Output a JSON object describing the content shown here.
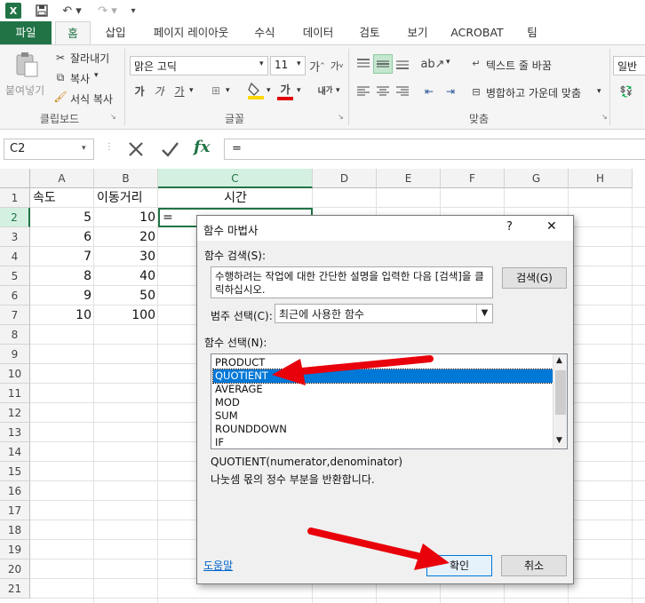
{
  "tabs": {
    "file": "파일",
    "home": "홈",
    "insert": "삽입",
    "page_layout": "페이지 레이아웃",
    "formulas": "수식",
    "data": "데이터",
    "review": "검토",
    "view": "보기",
    "acrobat": "ACROBAT",
    "team": "팀"
  },
  "ribbon": {
    "paste": "붙여넣기",
    "cut": "잘라내기",
    "copy": "복사",
    "format_painter": "서식 복사",
    "clipboard_group": "클립보드",
    "font_name": "맑은 고딕",
    "font_size": "11",
    "font_group": "글꼴",
    "wrap_text": "텍스트 줄 바꿈",
    "merge_center": "병합하고 가운데 맞춤",
    "alignment_group": "맞춤",
    "number_format": "일반"
  },
  "formula_bar": {
    "name_box": "C2",
    "fx": "fx",
    "content": "="
  },
  "sheet": {
    "columns": [
      "A",
      "B",
      "C",
      "D",
      "E",
      "F",
      "G",
      "H"
    ],
    "rows": [
      "1",
      "2",
      "3",
      "4",
      "5",
      "6",
      "7",
      "8",
      "9",
      "10",
      "11",
      "12",
      "13",
      "14",
      "15",
      "16",
      "17",
      "18",
      "19",
      "20",
      "21"
    ],
    "header_row": {
      "a": "속도",
      "b": "이동거리",
      "c": "시간"
    },
    "data": [
      {
        "a": "5",
        "b": "10",
        "c": "="
      },
      {
        "a": "6",
        "b": "20"
      },
      {
        "a": "7",
        "b": "30"
      },
      {
        "a": "8",
        "b": "40"
      },
      {
        "a": "9",
        "b": "50"
      },
      {
        "a": "10",
        "b": "100"
      }
    ]
  },
  "dialog": {
    "title": "함수 마법사",
    "help": "?",
    "close": "✕",
    "search_label": "함수 검색(S):",
    "search_text": "수행하려는 작업에 대한 간단한 설명을 입력한 다음 [검색]을 클릭하십시오.",
    "search_button": "검색(G)",
    "category_label": "범주 선택(C):",
    "category_value": "최근에 사용한 함수",
    "function_label": "함수 선택(N):",
    "functions": [
      "PRODUCT",
      "QUOTIENT",
      "AVERAGE",
      "MOD",
      "SUM",
      "ROUNDDOWN",
      "IF"
    ],
    "selected_function": "QUOTIENT",
    "signature": "QUOTIENT(numerator,denominator)",
    "description": "나눗셈 몫의 정수 부분을 반환합니다.",
    "help_link": "도움말",
    "ok": "확인",
    "cancel": "취소"
  },
  "colors": {
    "excel_green": "#217346",
    "selection_blue": "#0078d7",
    "arrow_red": "#e8000b"
  }
}
